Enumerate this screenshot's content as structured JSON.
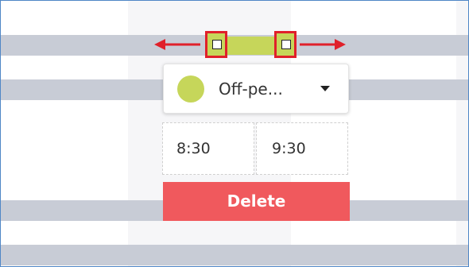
{
  "category": {
    "label": "Off-pe...",
    "color": "#c6d65a"
  },
  "time_range": {
    "start": "8:30",
    "end": "9:30"
  },
  "actions": {
    "delete_label": "Delete"
  },
  "colors": {
    "accent_red": "#e0202a",
    "delete_bg": "#f0595d",
    "row_band": "#c8ccd6",
    "frame_border": "#4f86c6"
  },
  "icons": {
    "left_handle": "resize-left-handle-icon",
    "right_handle": "resize-right-handle-icon",
    "left_arrow": "arrow-left-icon",
    "right_arrow": "arrow-right-icon",
    "dropdown": "chevron-down-icon"
  }
}
